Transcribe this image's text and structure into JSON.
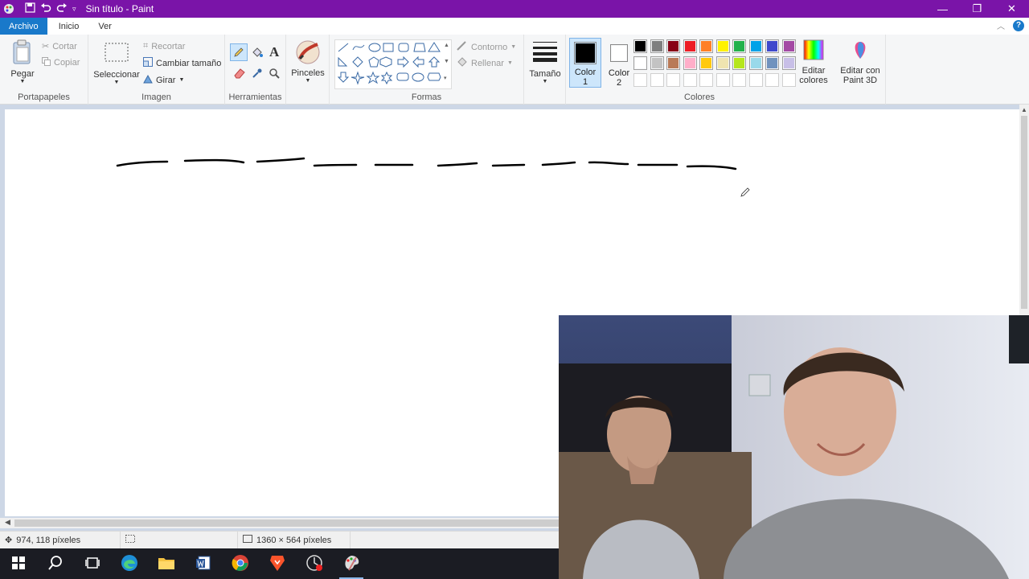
{
  "window": {
    "title": "Sin título - Paint",
    "controls": {
      "minimize": "—",
      "restore": "❐",
      "close": "✕"
    }
  },
  "menu": {
    "file": "Archivo",
    "tabs": [
      "Inicio",
      "Ver"
    ]
  },
  "ribbon": {
    "clipboard": {
      "label": "Portapapeles",
      "paste": "Pegar",
      "cut": "Cortar",
      "copy": "Copiar"
    },
    "image": {
      "label": "Imagen",
      "select": "Seleccionar",
      "crop": "Recortar",
      "resize": "Cambiar tamaño",
      "rotate": "Girar"
    },
    "tools": {
      "label": "Herramientas",
      "text_tool": "A"
    },
    "brushes": {
      "label": "Pinceles"
    },
    "shapes": {
      "label": "Formas",
      "outline": "Contorno",
      "fill": "Rellenar"
    },
    "size": {
      "label": "Tamaño"
    },
    "colors": {
      "label": "Colores",
      "color1_label": "Color",
      "color1_num": "1",
      "color2_label": "Color",
      "color2_num": "2",
      "color1": "#000000",
      "color2": "#ffffff",
      "palette_row1": [
        "#000000",
        "#7f7f7f",
        "#880015",
        "#ed1c24",
        "#ff7f27",
        "#fff200",
        "#22b14c",
        "#00a2e8",
        "#3f48cc",
        "#a349a4"
      ],
      "palette_row2": [
        "#ffffff",
        "#c3c3c3",
        "#b97a57",
        "#ffaec9",
        "#ffc90e",
        "#efe4b0",
        "#b5e61d",
        "#99d9ea",
        "#7092be",
        "#c8bfe7"
      ],
      "edit_colors": "Editar colores",
      "edit_paint3d": "Editar con Paint 3D"
    }
  },
  "status": {
    "cursor_pos": "974, 118 píxeles",
    "canvas_size": "1360 × 564 píxeles"
  },
  "colors": {
    "titlebar": "#7a14a8",
    "accent": "#1979ca",
    "taskbar": "#1b1c23"
  }
}
